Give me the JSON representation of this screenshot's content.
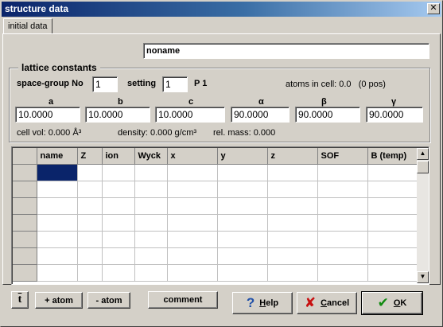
{
  "window": {
    "title": "structure data",
    "close_glyph": "✕"
  },
  "tabs": [
    {
      "label": "initial data"
    }
  ],
  "name_field": {
    "value": "noname"
  },
  "lattice": {
    "group_label": "lattice constants",
    "space_group_label": "space-group No",
    "space_group_value": "1",
    "setting_label": "setting",
    "setting_value": "1",
    "space_group_symbol": "P 1",
    "atoms_in_cell": "atoms in cell: 0.0   (0 pos)",
    "params": [
      {
        "label": "a",
        "value": "10.0000"
      },
      {
        "label": "b",
        "value": "10.0000"
      },
      {
        "label": "c",
        "value": "10.0000"
      },
      {
        "label": "α",
        "value": "90.0000"
      },
      {
        "label": "β",
        "value": "90.0000"
      },
      {
        "label": "γ",
        "value": "90.0000"
      }
    ],
    "cell_vol": "cell vol: 0.000 Å³",
    "density": "density: 0.000 g/cm³",
    "rel_mass": "rel. mass: 0.000"
  },
  "atom_table": {
    "columns": [
      "name",
      "Z",
      "ion",
      "Wyck",
      "x",
      "y",
      "z",
      "SOF",
      "B (temp)"
    ],
    "row_count": 7
  },
  "scrollbar": {
    "up_glyph": "▲",
    "down_glyph": "▼"
  },
  "buttons": {
    "transform_label": "t",
    "add_atom": "+ atom",
    "remove_atom": "- atom",
    "comment": "comment",
    "help": "Help",
    "cancel": "Cancel",
    "ok": "OK"
  },
  "icons": {
    "help": "question-icon",
    "cancel": "x-icon",
    "ok": "checkmark-icon"
  },
  "colors": {
    "selection": "#0a246a",
    "title_start": "#0a246a",
    "help_icon": "#1f4fa8",
    "cancel_icon": "#c81010",
    "ok_icon": "#108a10"
  }
}
